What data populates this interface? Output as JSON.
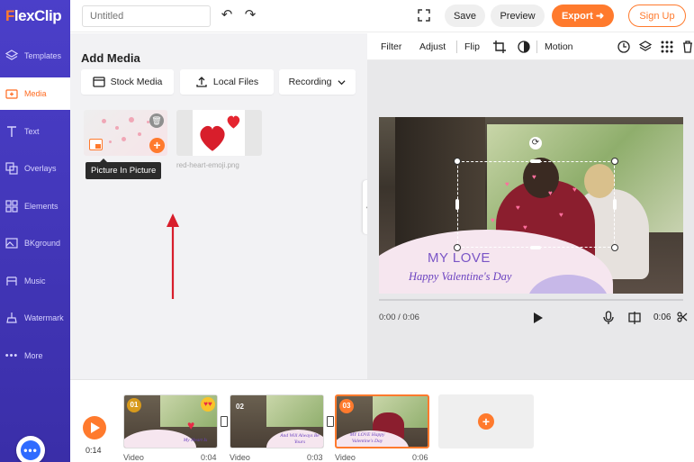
{
  "app": {
    "logo_prefix": "F",
    "logo_rest": "lexClip"
  },
  "sidebar": {
    "items": [
      {
        "label": "Templates",
        "icon": "layers-icon"
      },
      {
        "label": "Media",
        "icon": "folder-plus-icon",
        "active": true
      },
      {
        "label": "Text",
        "icon": "text-icon"
      },
      {
        "label": "Overlays",
        "icon": "overlays-icon"
      },
      {
        "label": "Elements",
        "icon": "elements-icon"
      },
      {
        "label": "BKground",
        "icon": "background-icon"
      },
      {
        "label": "Music",
        "icon": "music-icon"
      },
      {
        "label": "Watermark",
        "icon": "watermark-icon"
      },
      {
        "label": "More",
        "icon": "more-icon"
      }
    ],
    "help_glyph": "•••"
  },
  "topbar": {
    "title_placeholder": "Untitled",
    "save_label": "Save",
    "preview_label": "Preview",
    "export_label": "Export ➜",
    "signup_label": "Sign Up"
  },
  "media_panel": {
    "title": "Add Media",
    "stock_label": "Stock Media",
    "local_label": "Local Files",
    "recording_label": "Recording",
    "tooltip": "Picture In Picture",
    "item2_name": "red-heart-emoji.png"
  },
  "preview_toolbar": {
    "filter": "Filter",
    "adjust": "Adjust",
    "flip": "Flip",
    "motion": "Motion"
  },
  "preview": {
    "love_text": "MY LOVE",
    "vday_text": "Happy Valentine's Day",
    "time_current": "0:00 / 0:06",
    "duration": "0:06"
  },
  "timeline": {
    "play_time": "0:14",
    "clips": [
      {
        "num": "01",
        "caption": "My Heart Is",
        "type": "Video",
        "duration": "0:04"
      },
      {
        "num": "02",
        "caption": "And Will Always Be Yours",
        "type": "Video",
        "duration": "0:03"
      },
      {
        "num": "03",
        "caption": "MY LOVE Happy Valentine's Day",
        "type": "Video",
        "duration": "0:06"
      }
    ],
    "add_label": "+"
  },
  "colors": {
    "accent": "#ff7a2d",
    "sidebar": "#4b3fc9",
    "title_purple": "#6b42c0"
  }
}
